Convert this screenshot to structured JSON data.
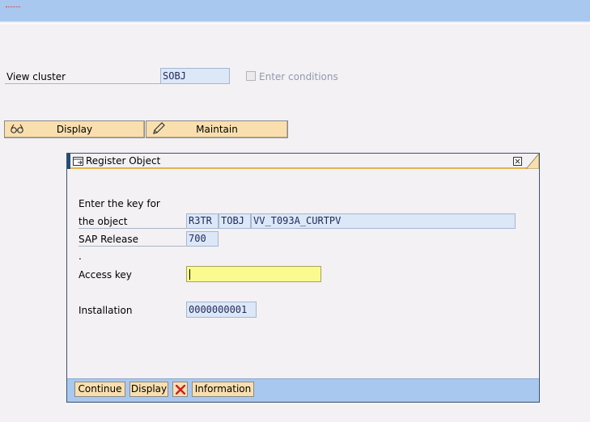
{
  "main": {
    "view_cluster_label": "View cluster",
    "view_cluster_value": "SOBJ",
    "enter_conditions_label": "Enter conditions",
    "display_button": "Display",
    "maintain_button": "Maintain"
  },
  "dialog": {
    "title": "Register Object",
    "enter_key_line1": "Enter the key for",
    "enter_key_line2": "the object",
    "obj_pgmid": "R3TR",
    "obj_type": "TOBJ",
    "obj_name": "VV_T093A_CURTPV",
    "sap_release_label": "SAP Release",
    "sap_release_value": "700",
    "dot": ".",
    "access_key_label": "Access key",
    "access_key_value": "",
    "installation_label": "Installation",
    "installation_value": "0000000001",
    "footer": {
      "continue": "Continue",
      "display": "Display",
      "information": "Information"
    }
  },
  "colors": {
    "topbar": "#a8c8ef",
    "button": "#f9dfae",
    "input": "#dce7f7",
    "required_input": "#fbfa8f",
    "cancel_red": "#cc1f1f"
  }
}
